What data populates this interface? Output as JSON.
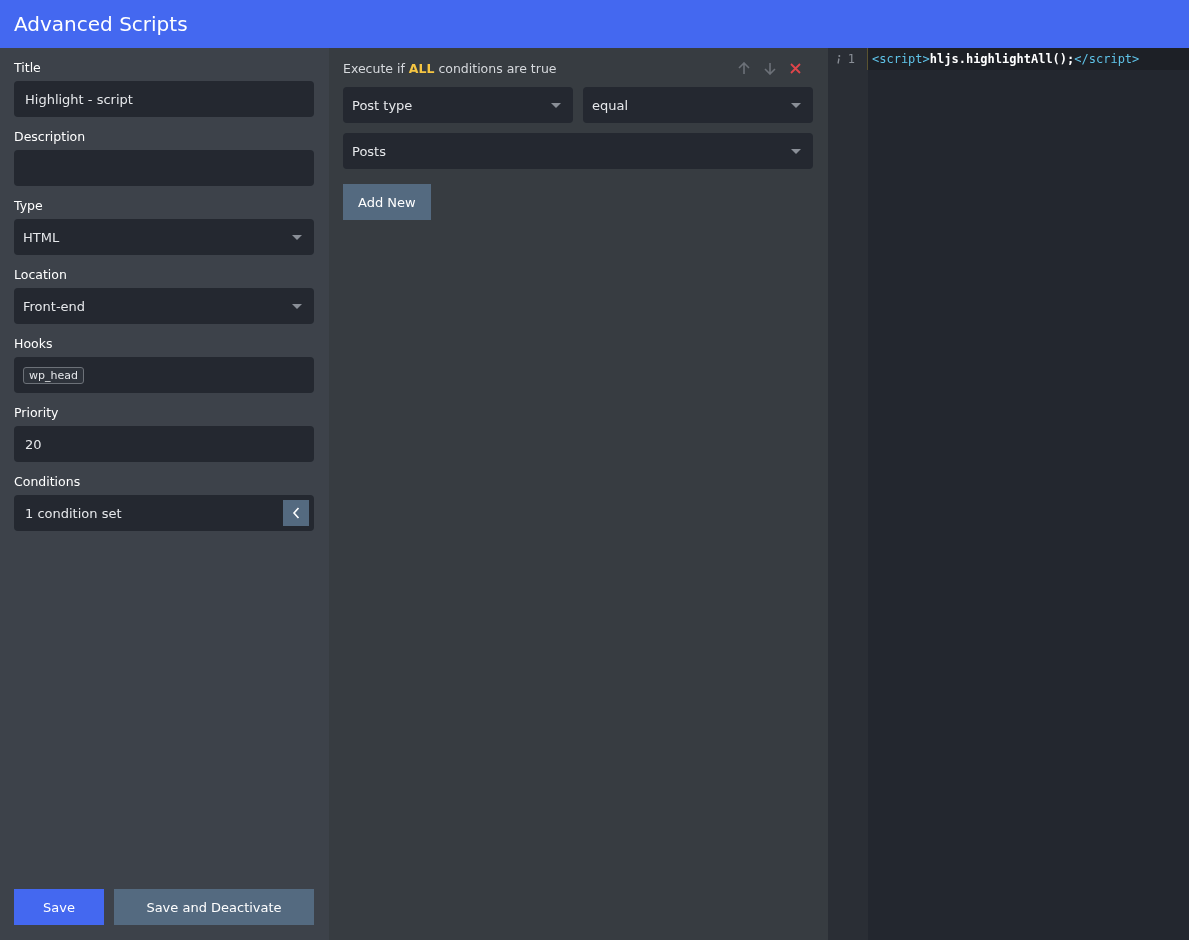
{
  "header": {
    "title": "Advanced Scripts"
  },
  "form": {
    "fields": [
      {
        "kind": "text",
        "label": "Title",
        "value": "Highlight - script"
      },
      {
        "kind": "text",
        "label": "Description"
      },
      {
        "kind": "select",
        "label": "Type",
        "value": "HTML"
      },
      {
        "kind": "select",
        "label": "Location",
        "value": "Front-end"
      },
      {
        "kind": "tags",
        "label": "Hooks",
        "tags": [
          "wp_head"
        ]
      },
      {
        "kind": "text",
        "label": "Priority",
        "value": "20"
      },
      {
        "kind": "toggle",
        "label": "Conditions",
        "value": "1 condition set"
      }
    ],
    "buttons": [
      {
        "label": "Save",
        "kind": "primary"
      },
      {
        "label": "Save and Deactivate",
        "kind": "secondary"
      }
    ]
  },
  "conditions": {
    "heading": "Execute if **ALL** conditions are true",
    "rows": [
      [
        "Post type",
        "equal"
      ],
      [
        "Posts"
      ]
    ],
    "add_button": "Add New"
  },
  "editor": {
    "lines": [
      {
        "number": "1",
        "tokens": [
          {
            "kind": "tag",
            "text": "<script>"
          },
          {
            "kind": "code",
            "text": "hljs.highlightAll();"
          },
          {
            "kind": "tag",
            "text": "</script>"
          }
        ]
      }
    ]
  }
}
